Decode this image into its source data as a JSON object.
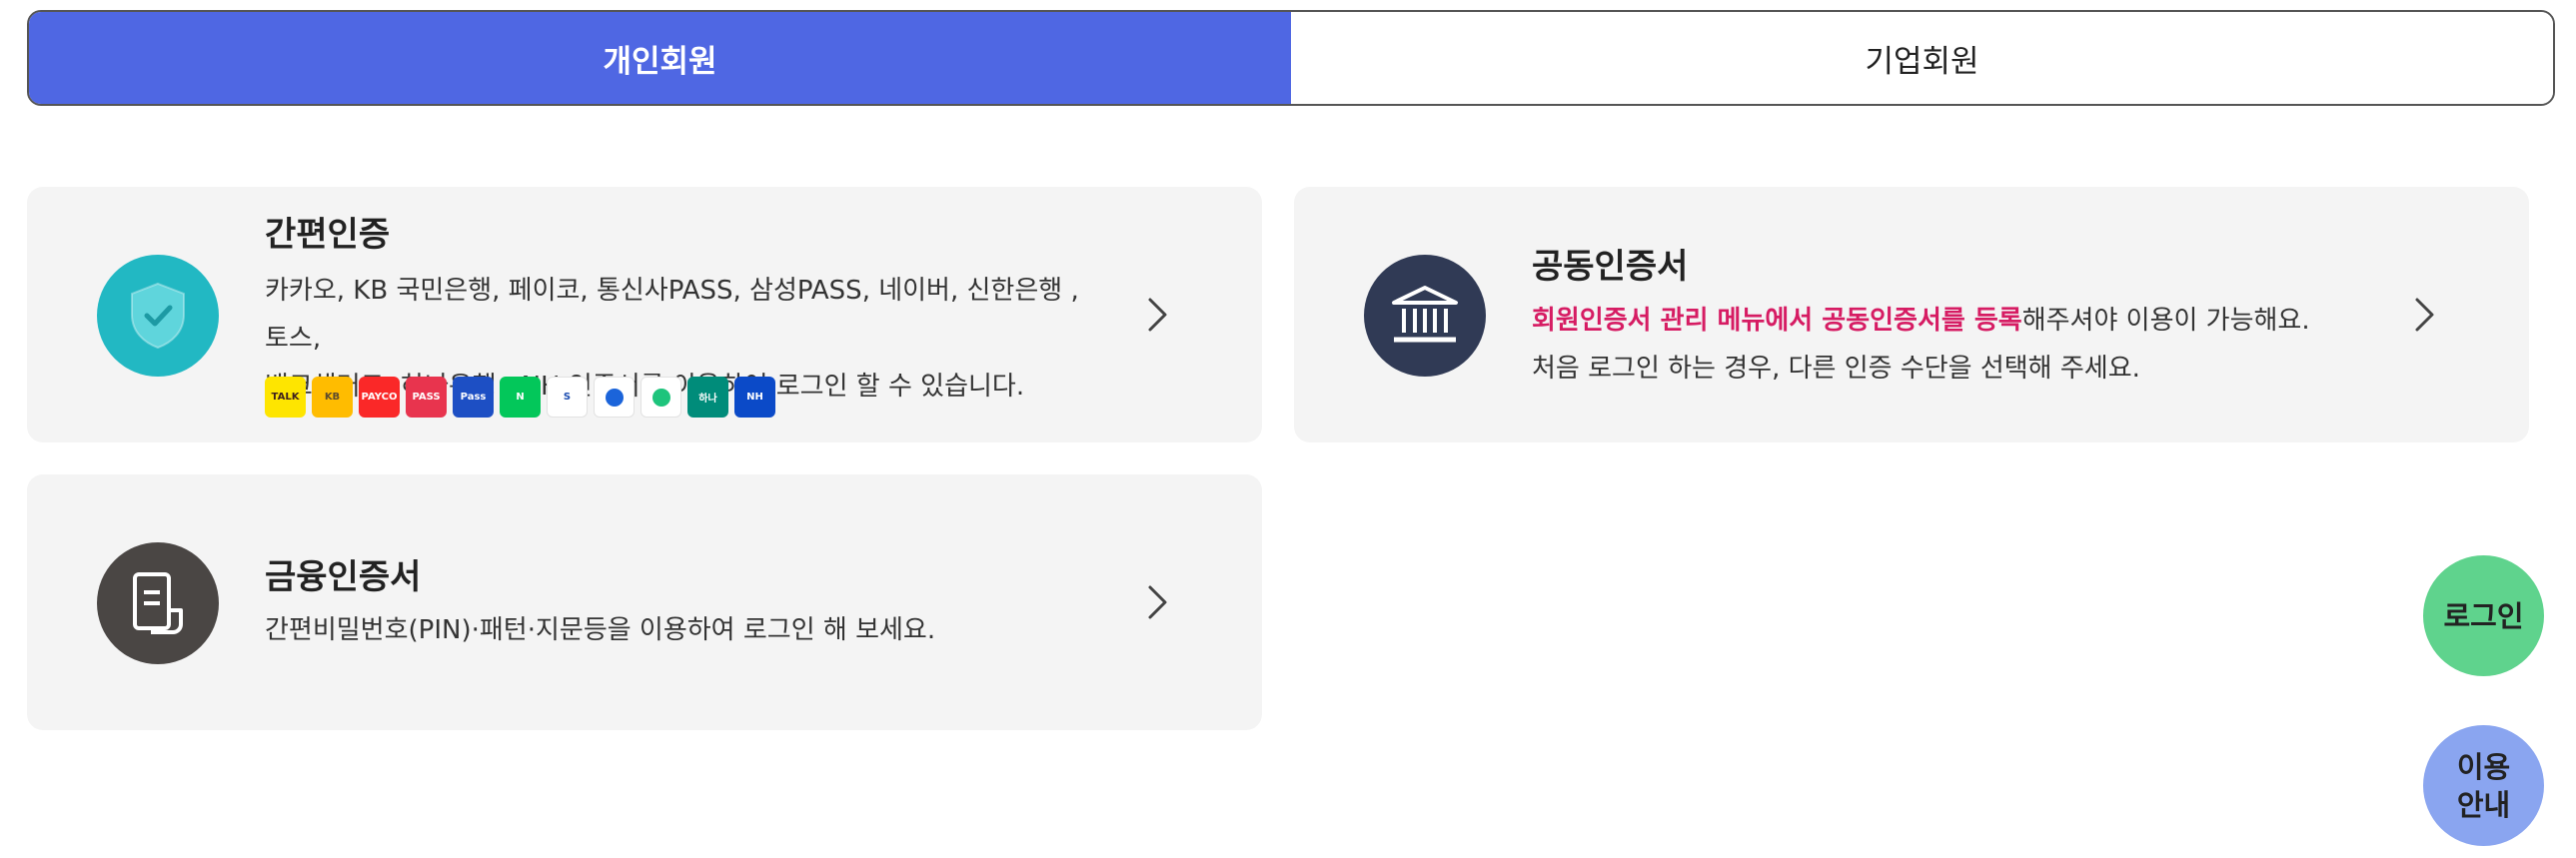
{
  "tabs": {
    "personal": "개인회원",
    "business": "기업회원"
  },
  "easy_auth": {
    "title": "간편인증",
    "line1": "카카오, KB 국민은행, 페이코, 통신사PASS, 삼성PASS, 네이버, 신한은행 , 토스,",
    "line2": "뱅크샐러드, 하나은행 , NH 인증서를 이용하여 로그인 할 수 있습니다.",
    "providers": [
      {
        "name": "kakao-talk",
        "label": "TALK",
        "color": "#fee500",
        "text_color": "#3c1e1e"
      },
      {
        "name": "kb-kookmin",
        "label": "KB",
        "color": "#ffbc00",
        "text_color": "#5b4a2e"
      },
      {
        "name": "payco",
        "label": "PAYCO",
        "color": "#fa2828",
        "text_color": "#ffffff"
      },
      {
        "name": "pass-telecom",
        "label": "PASS",
        "color": "#e8344e",
        "text_color": "#ffffff"
      },
      {
        "name": "samsung-pass",
        "label": "Pass",
        "color": "#1d4fc4",
        "text_color": "#ffffff"
      },
      {
        "name": "naver",
        "label": "N",
        "color": "#03c75a",
        "text_color": "#ffffff"
      },
      {
        "name": "shinhan-bank",
        "label": "S",
        "color": "#ffffff",
        "text_color": "#1c4db0"
      },
      {
        "name": "toss",
        "label": "",
        "color": "#ffffff",
        "text_color": "#1b64da"
      },
      {
        "name": "banksalad",
        "label": "",
        "color": "#ffffff",
        "text_color": "#1ec47c"
      },
      {
        "name": "hana-bank",
        "label": "하나",
        "color": "#008c7a",
        "text_color": "#ffffff"
      },
      {
        "name": "nh-bank",
        "label": "NH",
        "color": "#0b4ac8",
        "text_color": "#ffffff"
      }
    ]
  },
  "joint_cert": {
    "title": "공동인증서",
    "highlight": "회원인증서 관리 메뉴에서 공동인증서를 등록",
    "line1_rest": "해주셔야 이용이 가능해요.",
    "line2": "처음 로그인 하는 경우, 다른 인증 수단을 선택해 주세요."
  },
  "finance_cert": {
    "title": "금융인증서",
    "line1": "간편비밀번호(PIN)·패턴·지문등을 이용하여 로그인 해 보세요."
  },
  "floating": {
    "login": "로그인",
    "guide_line1": "이용",
    "guide_line2": "안내"
  },
  "colors": {
    "tab_active": "#4f67e3",
    "card_bg": "#f4f4f4",
    "easy_icon": "#22b8c3",
    "joint_icon": "#303a55",
    "finance_icon": "#4a4644",
    "highlight": "#d61c63",
    "login_btn": "#5fd38d",
    "guide_btn": "#8aa5f0"
  }
}
